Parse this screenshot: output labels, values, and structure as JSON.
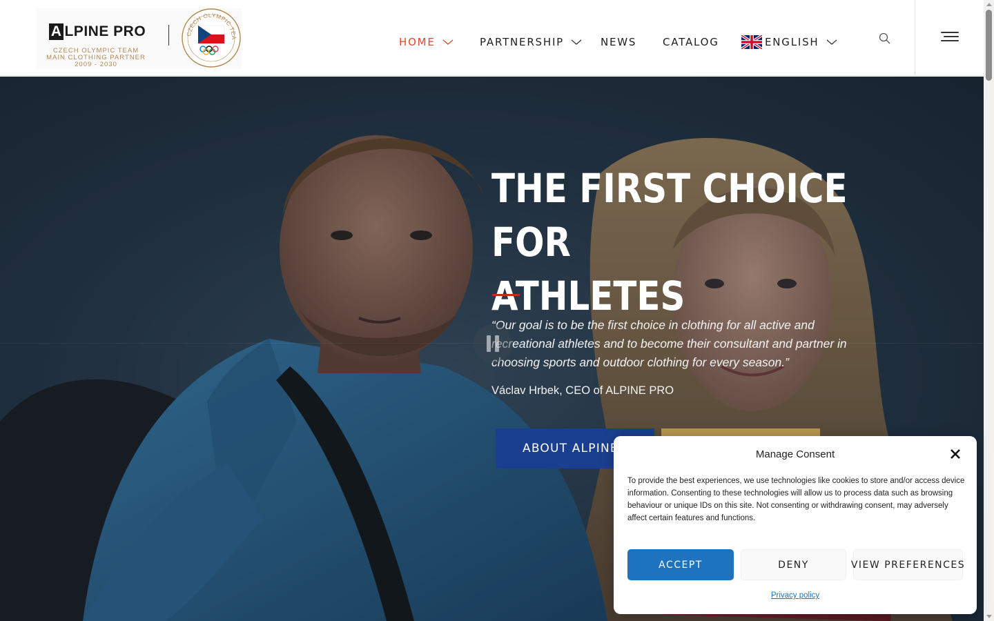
{
  "header": {
    "logo": {
      "brand_a": "A",
      "brand_rest": "LPINE PRO",
      "sub_lines": [
        "CZECH OLYMPIC TEAM",
        "MAIN CLOTHING PARTNER",
        "2009 - 2030"
      ],
      "seal_text": "CZECH OLYMPIC TEAM"
    },
    "nav": [
      {
        "label": "HOME",
        "active": true,
        "dropdown": true
      },
      {
        "label": "PARTNERSHIP",
        "active": false,
        "dropdown": true
      },
      {
        "label": "NEWS",
        "active": false,
        "dropdown": false
      },
      {
        "label": "CATALOG",
        "active": false,
        "dropdown": false
      },
      {
        "label": "ENGLISH",
        "active": false,
        "dropdown": true,
        "icon": "uk-flag-icon"
      }
    ],
    "search_icon": "search-icon",
    "menu_icon": "hamburger-menu-icon"
  },
  "hero": {
    "title_line1": "THE FIRST CHOICE FOR",
    "title_line2": "ATHLETES",
    "quote": "“Our goal is to be the first choice in clothing for all active and recreational athletes and to become their consultant and partner in choosing sports and outdoor clothing for every season.”",
    "author": "Václav Hrbek, CEO of ALPINE PRO",
    "button_about": "ABOUT ALPINE PRO",
    "pause_icon": "pause-icon"
  },
  "consent": {
    "title": "Manage Consent",
    "body": "To provide the best experiences, we use technologies like cookies to store and/or access device information. Consenting to these technologies will allow us to process data such as browsing behaviour or unique IDs on this site. Not consenting or withdrawing consent, may adversely affect certain features and functions.",
    "accept": "ACCEPT",
    "deny": "DENY",
    "preferences": "VIEW PREFERENCES",
    "privacy_link": "Privacy policy",
    "close_icon": "close-icon"
  },
  "colors": {
    "nav_active": "#e2442a",
    "accent_red": "#c8281e",
    "about_button": "#1b3f8f",
    "gold_button": "#b99653",
    "accept_button": "#1e73be",
    "logo_gold": "#b0874f"
  }
}
